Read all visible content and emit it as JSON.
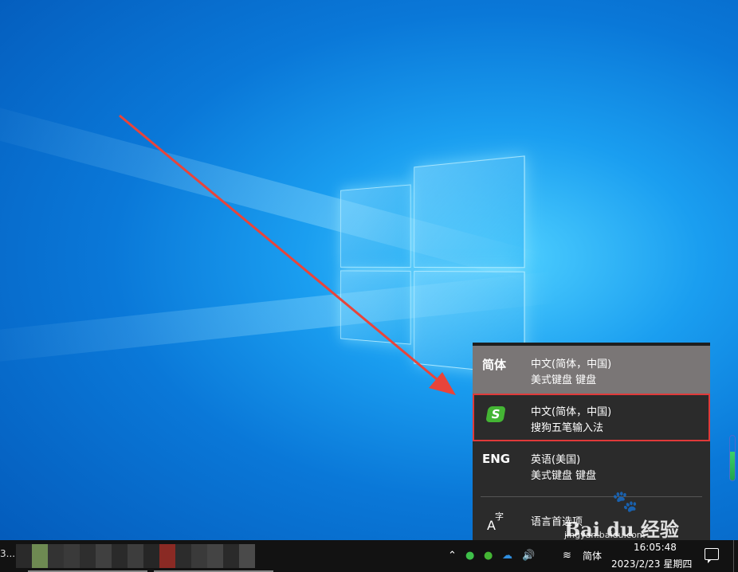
{
  "colors": {
    "menu_bg": "#2b2b2b",
    "menu_selected_bg": "#7a7676",
    "highlight_border": "#e03a3a",
    "arrow": "#e8443a",
    "sogou_green": "#44b534",
    "taskbar_bg": "#121212"
  },
  "language_menu": {
    "items": [
      {
        "abbr": "简体",
        "name": "中文(简体，中国)",
        "keyboard": "美式键盘 键盘",
        "state": "selected"
      },
      {
        "icon": "sogou-wubi-icon",
        "icon_text": "S",
        "name": "中文(简体，中国)",
        "keyboard": "搜狗五笔输入法",
        "state": "highlighted"
      },
      {
        "abbr": "ENG",
        "name": "英语(美国)",
        "keyboard": "美式键盘 键盘",
        "state": "normal"
      }
    ],
    "preferences": {
      "icon": "language-preferences-icon",
      "icon_a": "A",
      "icon_zi": "字",
      "label": "语言首选项"
    }
  },
  "watermark": {
    "paw": "🐾",
    "logo": "Bai du 经验",
    "url": "jingyan.baidu.com"
  },
  "taskbar": {
    "left_text": "3...",
    "tray_icons": [
      "chevron-up-icon",
      "wechat-icon",
      "sogou-tray-icon",
      "onedrive-icon",
      "volume-icon",
      "network-icon"
    ],
    "ime_indicator": "简体",
    "time": "16:05:48",
    "date": "2023/2/23 星期四"
  }
}
